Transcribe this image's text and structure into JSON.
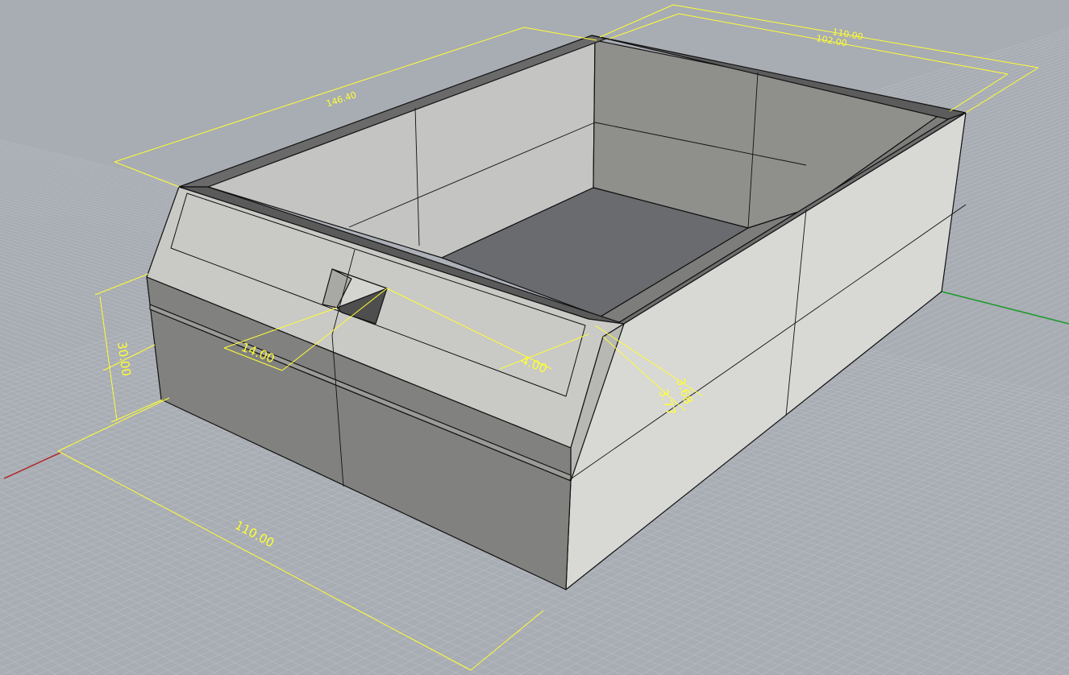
{
  "viewport": {
    "background": "#a8acb3",
    "grid_color": "#b7bbc1",
    "dimension_color": "#ffff33",
    "x_axis_color": "#b02020",
    "y_axis_color": "#1a9a2a"
  },
  "dimensions": {
    "overall_length": "110.00",
    "height": "30.00",
    "top_length": "146.40",
    "top_width_outer": "110.00",
    "top_width_inner": "102.00",
    "slot_width": "14.00",
    "slot_offset": "4.00",
    "rim_a": "3.68",
    "rim_b": "3.77"
  }
}
